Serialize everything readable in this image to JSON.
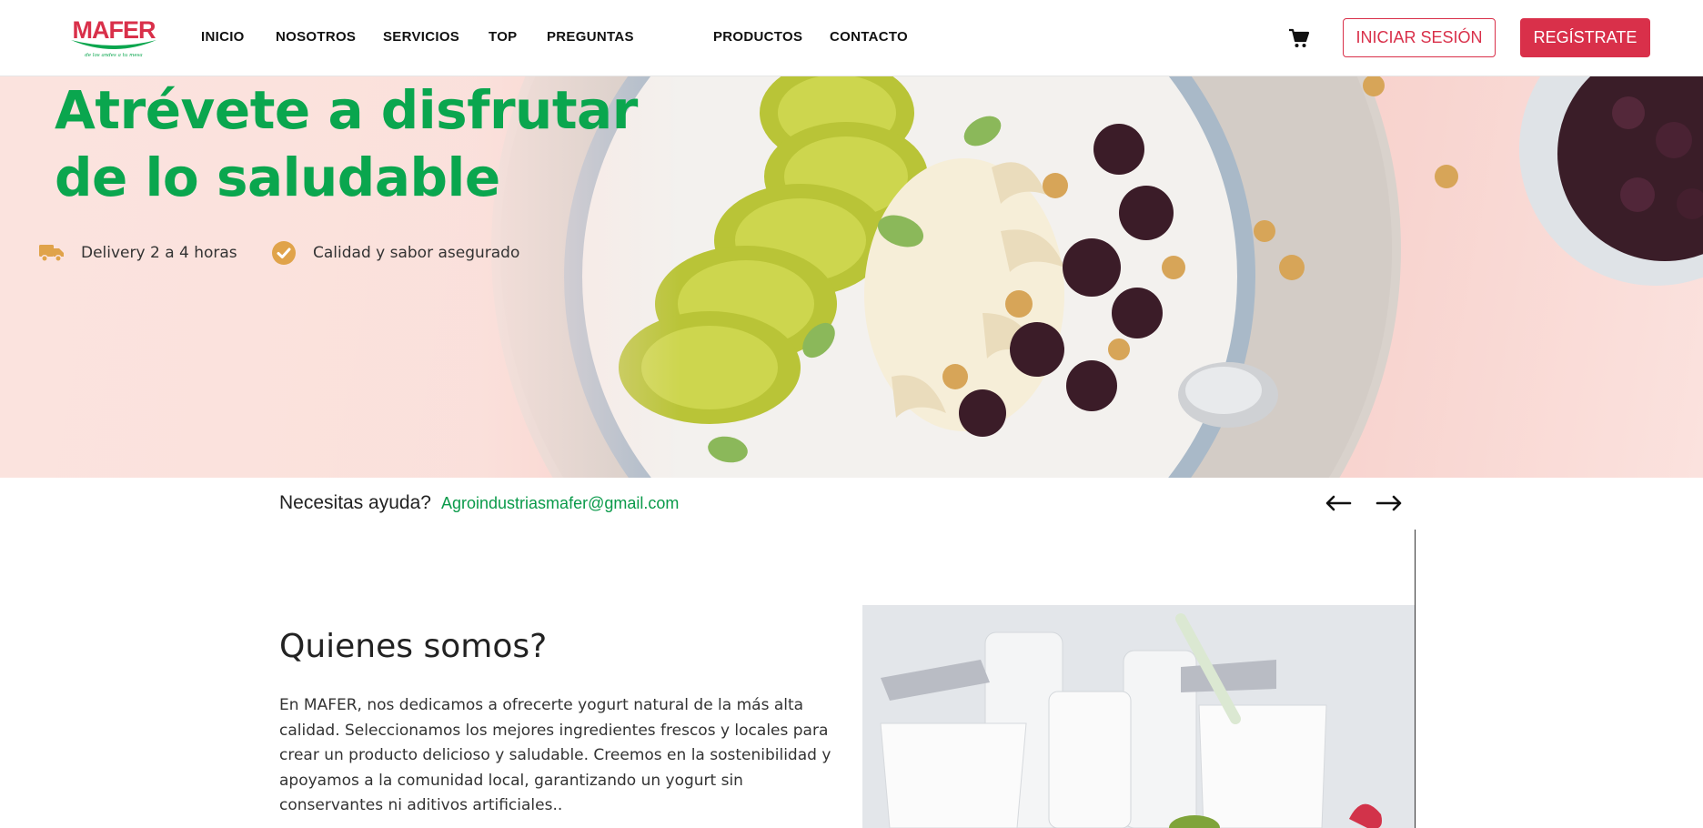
{
  "brand": {
    "name": "MAFER",
    "tagline": "de los andes a tu mesa",
    "accent": "#d9304a",
    "green": "#0aa64e"
  },
  "nav": {
    "links": [
      "INICIO",
      "NOSOTROS",
      "SERVICIOS",
      "TOP",
      "PREGUNTAS",
      "PRODUCTOS",
      "CONTACTO"
    ],
    "cart_icon": "shopping-cart-icon",
    "login_label": "INICIAR SESIÓN",
    "register_label": "REGÍSTRATE"
  },
  "hero": {
    "title_line1": "Atrévete a disfrutar",
    "title_line2": "de lo saludable",
    "features": [
      {
        "icon": "truck-icon",
        "label": "Delivery 2 a 4 horas"
      },
      {
        "icon": "check-circle-icon",
        "label": "Calidad y sabor asegurado"
      }
    ],
    "icon_color": "#e0a34a"
  },
  "help": {
    "label": "Necesitas ayuda?",
    "email": "Agroindustriasmafer@gmail.com",
    "prev_icon": "arrow-left-icon",
    "next_icon": "arrow-right-icon"
  },
  "about": {
    "title": "Quienes somos?",
    "text": "En MAFER, nos dedicamos a ofrecerte yogurt natural de la más alta calidad. Seleccionamos los mejores ingredientes frescos y locales para crear un producto delicioso y saludable. Creemos en la sostenibilidad y apoyamos a la comunidad local, garantizando un yogurt sin conservantes ni aditivos artificiales.."
  }
}
